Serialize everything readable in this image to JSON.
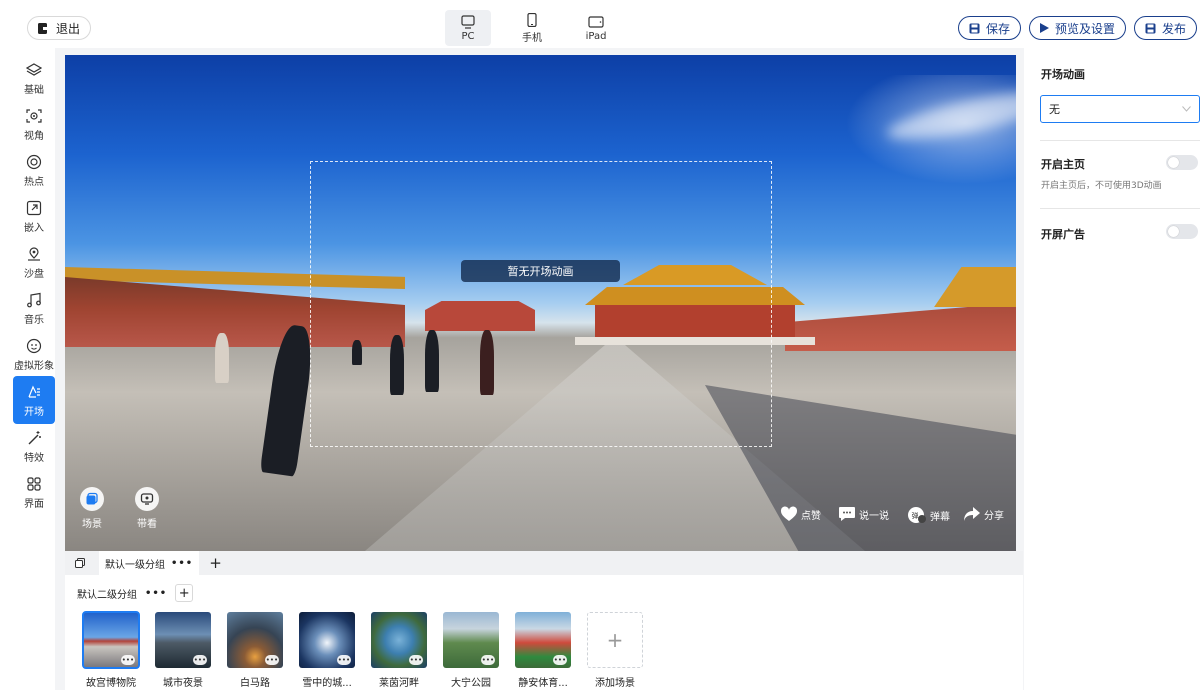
{
  "header": {
    "exit_label": "退出",
    "devices": [
      {
        "label": "PC",
        "icon": "monitor-icon",
        "active": true
      },
      {
        "label": "手机",
        "icon": "phone-icon",
        "active": false
      },
      {
        "label": "iPad",
        "icon": "tablet-icon",
        "active": false
      }
    ],
    "save_label": "保存",
    "preview_label": "预览及设置",
    "publish_label": "发布",
    "accent_color": "#1a3f8c"
  },
  "sidebar": {
    "items": [
      {
        "label": "基础",
        "icon": "layers-icon"
      },
      {
        "label": "视角",
        "icon": "view-angle-icon"
      },
      {
        "label": "热点",
        "icon": "hotspot-icon"
      },
      {
        "label": "嵌入",
        "icon": "embed-icon"
      },
      {
        "label": "沙盘",
        "icon": "map-pin-icon"
      },
      {
        "label": "音乐",
        "icon": "music-icon"
      },
      {
        "label": "虚拟形象",
        "icon": "avatar-face-icon"
      },
      {
        "label": "开场",
        "icon": "opening-icon",
        "active": true
      },
      {
        "label": "特效",
        "icon": "magic-wand-icon"
      },
      {
        "label": "界面",
        "icon": "grid-icon"
      }
    ],
    "active_color": "#1e7cf2"
  },
  "preview": {
    "overlay_text": "暂无开场动画",
    "scene_button_label": "场景",
    "guide_button_label": "带看",
    "actions": [
      {
        "label": "点赞",
        "icon": "heart-icon"
      },
      {
        "label": "说一说",
        "icon": "comment-icon"
      },
      {
        "label": "弹幕",
        "icon": "danmaku-icon"
      },
      {
        "label": "分享",
        "icon": "share-icon"
      }
    ]
  },
  "groups": {
    "level1_label": "默认一级分组",
    "level2_label": "默认二级分组",
    "more_dots": "•••",
    "add_symbol": "+"
  },
  "scenes": [
    {
      "label": "故宫博物院",
      "selected": true
    },
    {
      "label": "城市夜景"
    },
    {
      "label": "白马路"
    },
    {
      "label": "雪中的城..."
    },
    {
      "label": "莱茵河畔"
    },
    {
      "label": "大宁公园"
    },
    {
      "label": "静安体育..."
    }
  ],
  "add_scene_label": "添加场景",
  "thumb_more": "•••",
  "settings": {
    "opening_anim_title": "开场动画",
    "opening_anim_value": "无",
    "homepage_label": "开启主页",
    "homepage_hint": "开启主页后，不可使用3D动画",
    "homepage_enabled": false,
    "splash_ad_label": "开屏广告",
    "splash_ad_enabled": false
  }
}
